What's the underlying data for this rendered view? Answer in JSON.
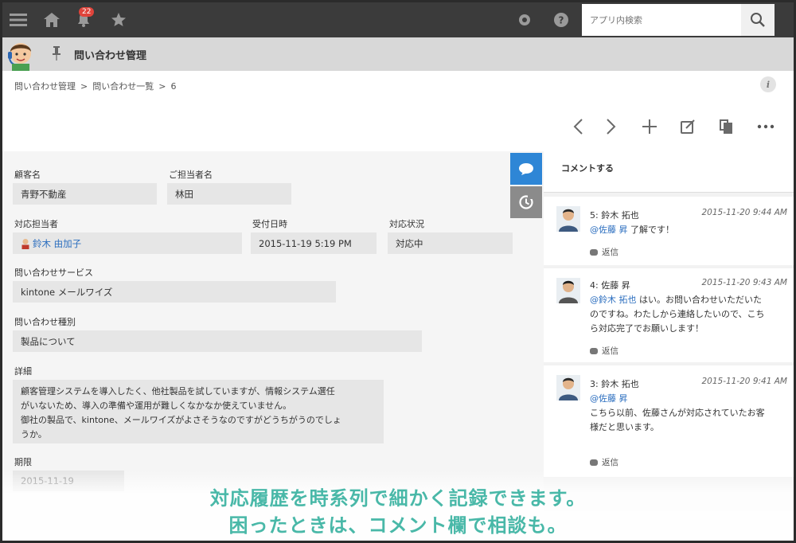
{
  "header": {
    "notification_count": "22",
    "search_placeholder": "アプリ内検索"
  },
  "app": {
    "title": "問い合わせ管理"
  },
  "breadcrumb": [
    "問い合わせ管理",
    ">",
    "問い合わせ一覧",
    ">",
    "6"
  ],
  "info_label": "i",
  "fields": {
    "customer_label": "顧客名",
    "customer_value": "青野不動産",
    "contact_label": "ご担当者名",
    "contact_value": "林田",
    "assignee_label": "対応担当者",
    "assignee_value": "鈴木 由加子",
    "received_label": "受付日時",
    "received_value": "2015-11-19 5:19 PM",
    "status_label": "対応状況",
    "status_value": "対応中",
    "service_label": "問い合わせサービス",
    "service_value": "kintone メールワイズ",
    "type_label": "問い合わせ種別",
    "type_value": "製品について",
    "detail_label": "詳細",
    "detail_lines": [
      "顧客管理システムを導入したく、他社製品を試していますが、情報システム選任",
      "がいないため、導入の準備や運用が難しくなかなか使えていません。",
      "御社の製品で、kintone、メールワイズがよさそうなのですがどうちがうのでしょ",
      "うか。"
    ],
    "deadline_label": "期限",
    "deadline_value": "2015-11-19"
  },
  "comments": {
    "input_placeholder": "コメントする",
    "items": [
      {
        "author": "5: 鈴木 拓也",
        "time": "2015-11-20 9:44 AM",
        "mention": "@佐藤 昇",
        "body": " 了解です！",
        "extra": [],
        "reply": "返信"
      },
      {
        "author": "4: 佐藤 昇",
        "time": "2015-11-20 9:43 AM",
        "mention": "@鈴木 拓也",
        "body": " はい。お問い合わせいただいた",
        "extra": [
          "のですね。わたしから連絡したいので、こち",
          "ら対応完了でお願いします！"
        ],
        "reply": "返信"
      },
      {
        "author": "3: 鈴木 拓也",
        "time": "2015-11-20 9:41 AM",
        "mention": "@佐藤 昇",
        "body": "",
        "extra": [
          "こちら以前、佐藤さんが対応されていたお客",
          "様だと思います。"
        ],
        "reply": "返信"
      }
    ]
  },
  "caption": {
    "line1": "対応履歴を時系列で細かく記録できます。",
    "line2": "困ったときは、コメント欄で相談も。"
  },
  "colors": {
    "topbar": "#3b3b3b",
    "accent_blue": "#2e86d6",
    "caption_teal": "#49b8a8",
    "link": "#2b6ebf"
  }
}
